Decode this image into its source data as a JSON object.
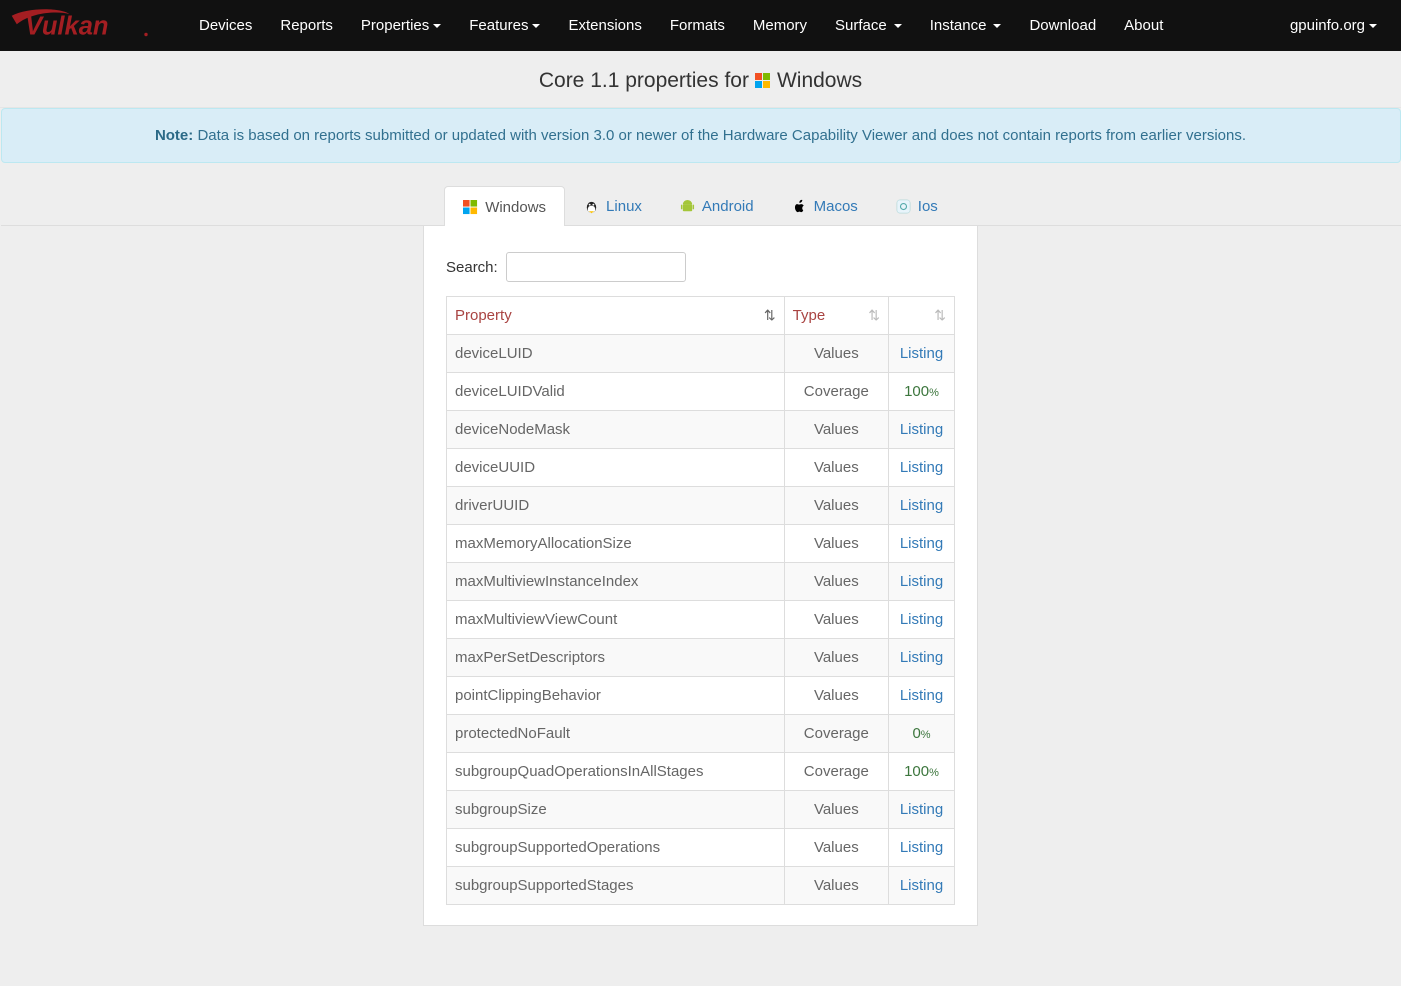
{
  "brand": "Vulkan",
  "nav": {
    "items": [
      "Devices",
      "Reports",
      "Properties",
      "Features",
      "Extensions",
      "Formats",
      "Memory",
      "Surface",
      "Instance",
      "Download",
      "About"
    ],
    "dropdown_idx": [
      2,
      3,
      7,
      8
    ],
    "right": "gpuinfo.org"
  },
  "title_prefix": "Core 1.1 properties for",
  "title_os": "Windows",
  "alert_label": "Note:",
  "alert_text": "Data is based on reports submitted or updated with version 3.0 or newer of the Hardware Capability Viewer and does not contain reports from earlier versions.",
  "os_tabs": [
    "Windows",
    "Linux",
    "Android",
    "Macos",
    "Ios"
  ],
  "active_tab": 0,
  "search_label": "Search:",
  "search_value": "",
  "columns": [
    "Property",
    "Type",
    ""
  ],
  "rows": [
    {
      "p": "deviceLUID",
      "t": "Values",
      "v": "Listing",
      "k": "link"
    },
    {
      "p": "deviceLUIDValid",
      "t": "Coverage",
      "v": "100",
      "k": "pct"
    },
    {
      "p": "deviceNodeMask",
      "t": "Values",
      "v": "Listing",
      "k": "link"
    },
    {
      "p": "deviceUUID",
      "t": "Values",
      "v": "Listing",
      "k": "link"
    },
    {
      "p": "driverUUID",
      "t": "Values",
      "v": "Listing",
      "k": "link"
    },
    {
      "p": "maxMemoryAllocationSize",
      "t": "Values",
      "v": "Listing",
      "k": "link"
    },
    {
      "p": "maxMultiviewInstanceIndex",
      "t": "Values",
      "v": "Listing",
      "k": "link"
    },
    {
      "p": "maxMultiviewViewCount",
      "t": "Values",
      "v": "Listing",
      "k": "link"
    },
    {
      "p": "maxPerSetDescriptors",
      "t": "Values",
      "v": "Listing",
      "k": "link"
    },
    {
      "p": "pointClippingBehavior",
      "t": "Values",
      "v": "Listing",
      "k": "link"
    },
    {
      "p": "protectedNoFault",
      "t": "Coverage",
      "v": "0",
      "k": "pct"
    },
    {
      "p": "subgroupQuadOperationsInAllStages",
      "t": "Coverage",
      "v": "100",
      "k": "pct"
    },
    {
      "p": "subgroupSize",
      "t": "Values",
      "v": "Listing",
      "k": "link"
    },
    {
      "p": "subgroupSupportedOperations",
      "t": "Values",
      "v": "Listing",
      "k": "link"
    },
    {
      "p": "subgroupSupportedStages",
      "t": "Values",
      "v": "Listing",
      "k": "link"
    }
  ]
}
